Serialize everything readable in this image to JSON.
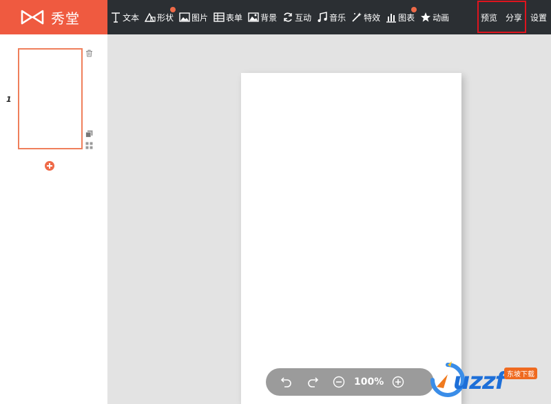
{
  "brand": {
    "name": "秀堂"
  },
  "toolbar": {
    "items": [
      {
        "label": "文本",
        "icon": "text-icon",
        "dot": false
      },
      {
        "label": "形状",
        "icon": "shape-icon",
        "dot": true
      },
      {
        "label": "图片",
        "icon": "image-icon",
        "dot": false
      },
      {
        "label": "表单",
        "icon": "form-icon",
        "dot": false
      },
      {
        "label": "背景",
        "icon": "background-icon",
        "dot": false
      },
      {
        "label": "互动",
        "icon": "interact-icon",
        "dot": false
      },
      {
        "label": "音乐",
        "icon": "music-icon",
        "dot": false
      },
      {
        "label": "特效",
        "icon": "effects-icon",
        "dot": false
      },
      {
        "label": "图表",
        "icon": "chart-icon",
        "dot": true
      },
      {
        "label": "动画",
        "icon": "star-icon",
        "dot": false
      }
    ],
    "preview_label": "预览",
    "share_label": "分享",
    "settings_label": "设置"
  },
  "sidebar": {
    "page_number": "1"
  },
  "zoom": {
    "value": "100%"
  },
  "watermark": {
    "text": "uzzf",
    "badge": "东坡下载"
  },
  "colors": {
    "brand": "#ef5a40",
    "topbar": "#2b2f33",
    "accent": "#ef6a48",
    "highlight": "#e0141e"
  }
}
